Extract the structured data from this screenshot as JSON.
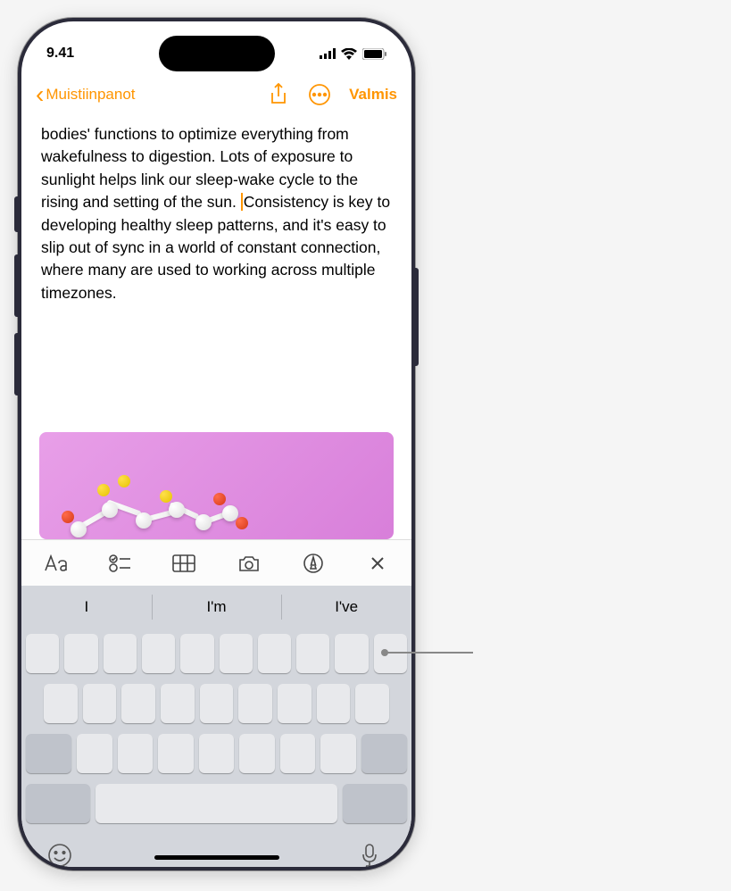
{
  "status": {
    "time": "9.41"
  },
  "nav": {
    "back_label": "Muistiinpanot",
    "done_label": "Valmis"
  },
  "note": {
    "text_before": "bodies' functions to optimize everything from wakefulness to digestion. Lots of exposure to sunlight helps link our sleep-wake cycle to the rising and setting of the sun. ",
    "text_after": "Consistency is key to developing healthy sleep patterns, and it's easy to slip out of sync in a world of constant connection, where many are used to working across multiple timezones."
  },
  "suggestions": [
    "I",
    "I'm",
    "I've"
  ]
}
